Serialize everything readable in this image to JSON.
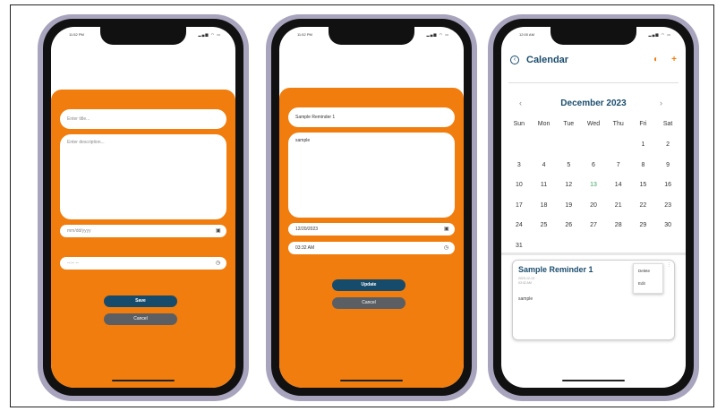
{
  "phone1": {
    "status_time": "11:52 PM",
    "title_placeholder": "Enter title...",
    "description_placeholder": "Enter description...",
    "date_placeholder": "mm/dd/yyyy",
    "time_placeholder": "--:-- --",
    "save_label": "Save",
    "cancel_label": "Cancel",
    "calendar_icon": "calendar-icon",
    "clock_icon": "clock-icon"
  },
  "phone2": {
    "status_time": "11:52 PM",
    "title_value": "Sample Reminder 1",
    "description_value": "sample",
    "date_value": "12/20/2023",
    "time_value": "03:32 AM",
    "update_label": "Update",
    "cancel_label": "Cancel"
  },
  "phone3": {
    "status_time": "12:00 AM",
    "header_title": "Calendar",
    "month_title": "December 2023",
    "weekdays": [
      "Sun",
      "Mon",
      "Tue",
      "Wed",
      "Thu",
      "Fri",
      "Sat"
    ],
    "days": [
      "",
      "",
      "",
      "",
      "",
      "1",
      "2",
      "3",
      "4",
      "5",
      "6",
      "7",
      "8",
      "9",
      "10",
      "11",
      "12",
      "13",
      "14",
      "15",
      "16",
      "17",
      "18",
      "19",
      "20",
      "21",
      "22",
      "23",
      "24",
      "25",
      "26",
      "27",
      "28",
      "29",
      "30",
      "31"
    ],
    "today": "13",
    "event": {
      "title": "Sample Reminder 1",
      "date": "2023-12-13",
      "time": "03:32 AM",
      "description": "sample"
    },
    "menu": {
      "delete_label": "Delete",
      "edit_label": "Edit"
    },
    "accent_color": "#f07d0e",
    "primary_color": "#1b4d6e"
  }
}
